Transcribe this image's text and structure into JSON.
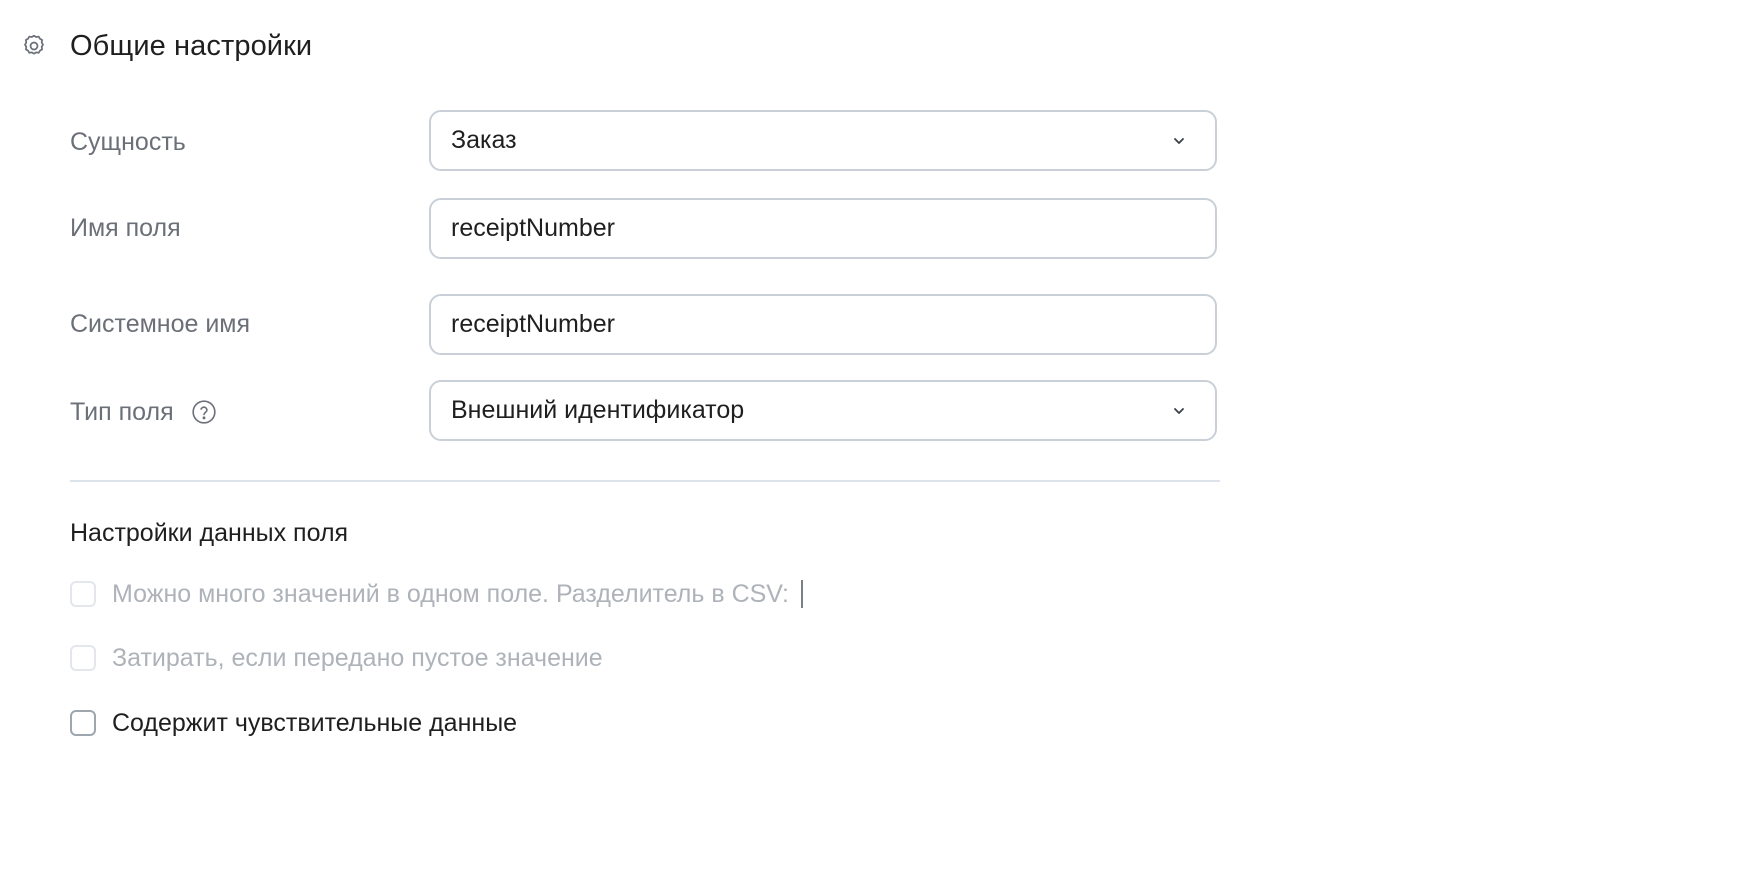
{
  "header": {
    "title": "Общие настройки",
    "icon": "gear-icon"
  },
  "form": {
    "entity": {
      "label": "Сущность",
      "value": "Заказ"
    },
    "field_name": {
      "label": "Имя поля",
      "value": "receiptNumber"
    },
    "system_name": {
      "label": "Системное имя",
      "value": "receiptNumber"
    },
    "field_type": {
      "label": "Тип поля",
      "value": "Внешний идентификатор",
      "help_icon": "question-circle-icon"
    }
  },
  "data_settings": {
    "title": "Настройки данных поля",
    "options": [
      {
        "label": "Можно много значений в одном поле. Разделитель в CSV:",
        "checked": false,
        "disabled": true
      },
      {
        "label": "Затирать, если передано пустое значение",
        "checked": false,
        "disabled": true
      },
      {
        "label": "Содержит чувствительные данные",
        "checked": false,
        "disabled": false
      }
    ]
  },
  "colors": {
    "border": "#c9d0d8",
    "label": "#6b7078",
    "disabled_text": "#aeb3b9",
    "divider": "#dde3ea"
  }
}
